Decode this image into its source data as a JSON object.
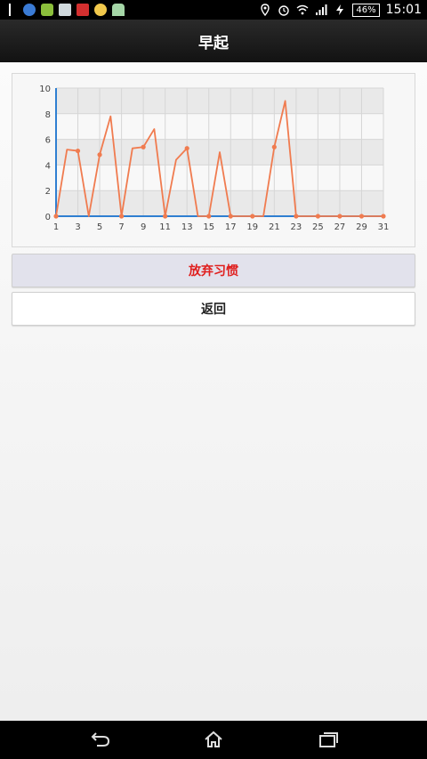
{
  "status_bar": {
    "time": "15:01",
    "battery": "46%",
    "left_icons": [
      "usb-icon",
      "chrome-icon",
      "wechat-icon",
      "gallery-icon",
      "app-icon",
      "weather-icon",
      "android-icon"
    ],
    "right_icons": [
      "location-icon",
      "alarm-icon",
      "wifi-icon",
      "signal-icon",
      "charging-icon"
    ]
  },
  "header": {
    "title": "早起"
  },
  "chart_data": {
    "type": "line",
    "title": "",
    "xlabel": "",
    "ylabel": "",
    "x": [
      1,
      2,
      3,
      4,
      5,
      6,
      7,
      8,
      9,
      10,
      11,
      12,
      13,
      14,
      15,
      16,
      17,
      18,
      19,
      20,
      21,
      22,
      23,
      24,
      25,
      26,
      27,
      28,
      29,
      30,
      31
    ],
    "values": [
      0,
      5.2,
      5.1,
      0,
      4.8,
      7.8,
      0,
      5.3,
      5.4,
      6.8,
      0,
      4.4,
      5.3,
      0,
      0,
      5.0,
      0,
      0,
      0,
      0,
      5.4,
      9.0,
      0,
      0,
      0,
      0,
      0,
      0,
      0,
      0,
      0
    ],
    "x_tick_labels": [
      "1",
      "3",
      "5",
      "7",
      "9",
      "11",
      "13",
      "15",
      "17",
      "19",
      "21",
      "23",
      "25",
      "27",
      "29",
      "31"
    ],
    "y_tick_labels": [
      "0",
      "2",
      "4",
      "6",
      "8",
      "10"
    ],
    "ylim": [
      0,
      10
    ],
    "grid": true,
    "series_color": "#f07b4f",
    "axis_color": "#2f7fd1"
  },
  "actions": {
    "abandon_label": "放弃习惯",
    "back_label": "返回"
  },
  "nav_bar": {
    "icons": [
      "back-icon",
      "home-icon",
      "recents-icon"
    ]
  }
}
